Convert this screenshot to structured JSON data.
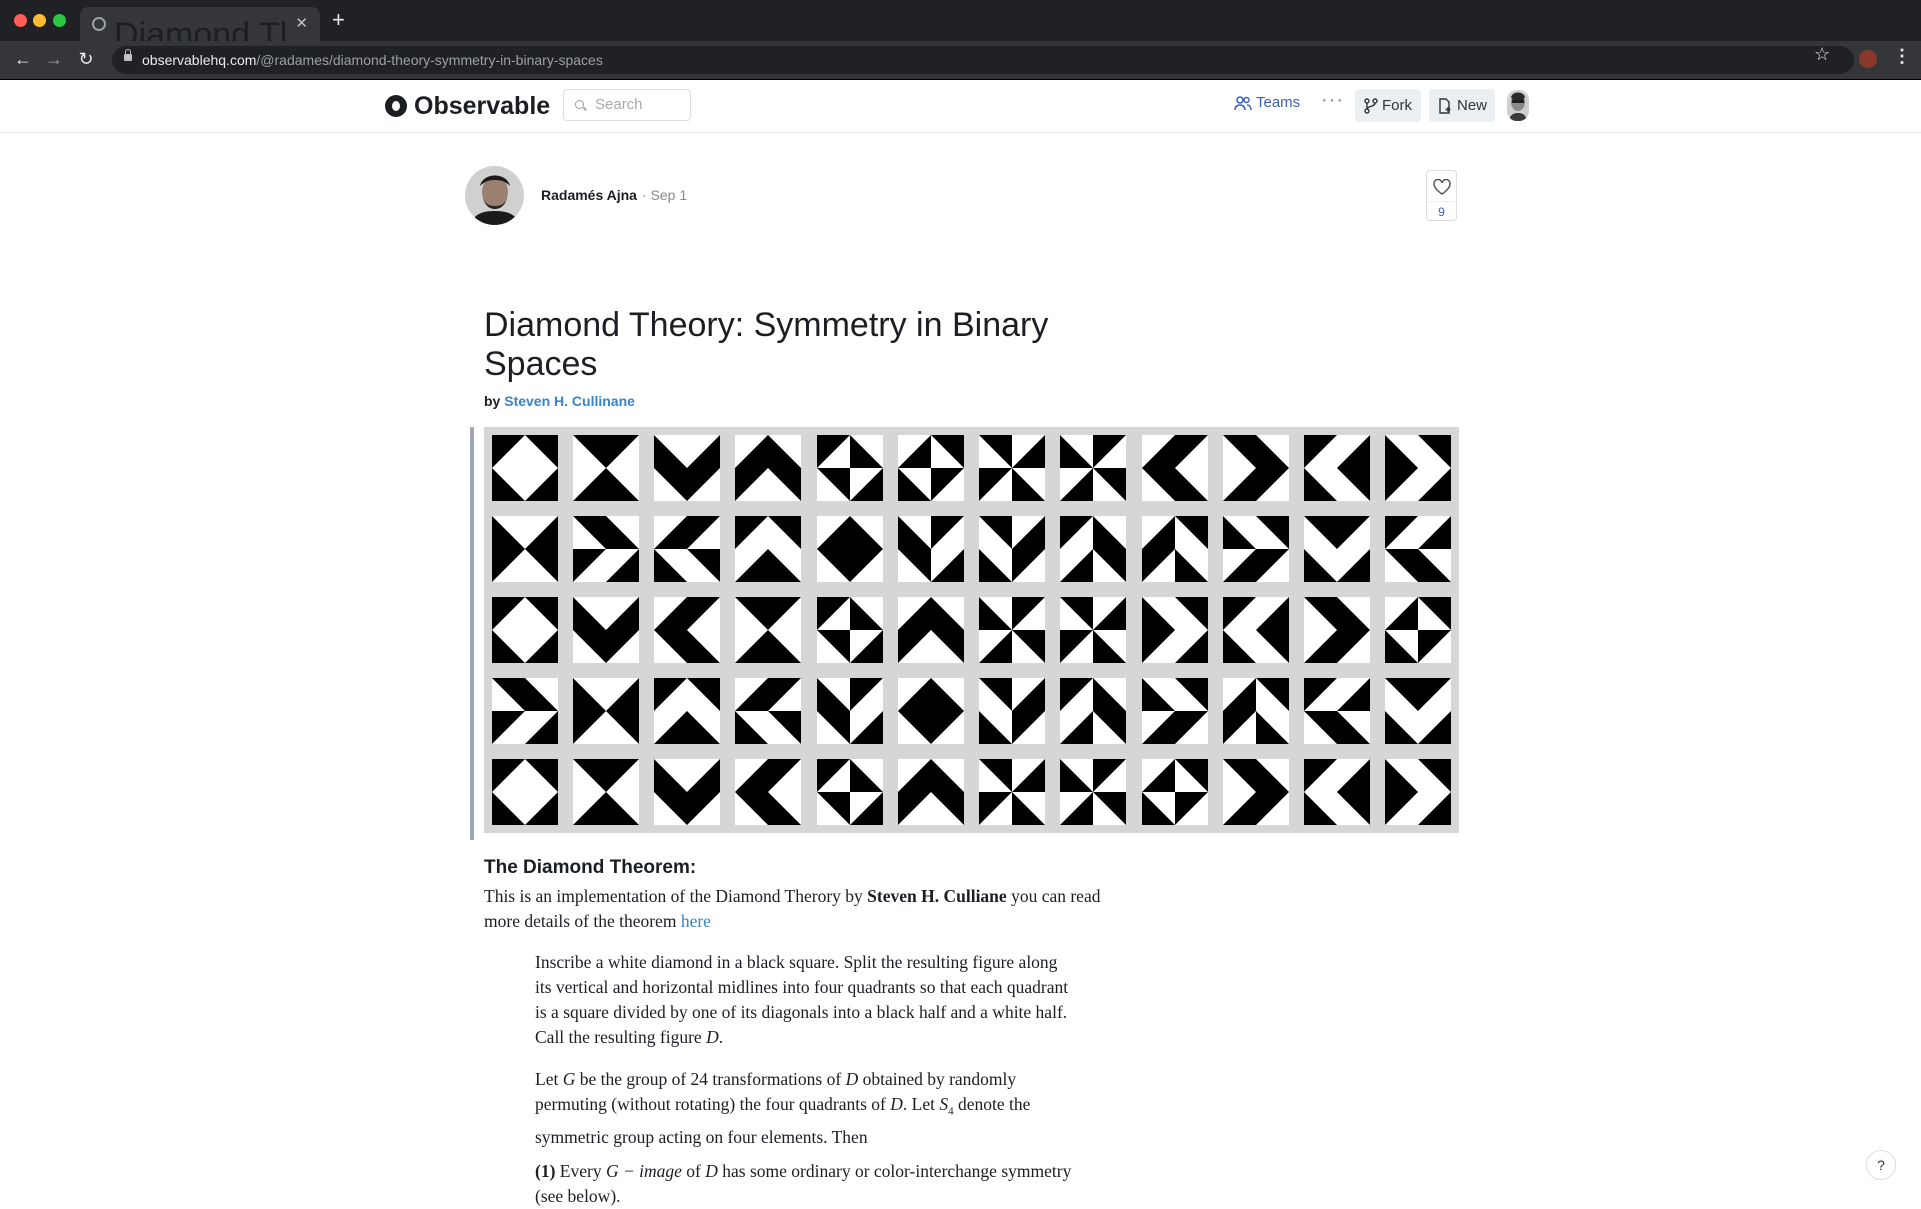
{
  "browser": {
    "tab_title": "Diamond Theory: Symmetry in Binary Spaces",
    "url_host": "observablehq.com",
    "url_path": "/@radames/diamond-theory-symmetry-in-binary-spaces",
    "traffic_colors": [
      "#ff5f57",
      "#febc2e",
      "#28c840"
    ]
  },
  "header": {
    "logo": "Observable",
    "search_placeholder": "Search",
    "teams": "Teams",
    "fork": "Fork",
    "new": "New"
  },
  "meta": {
    "author": "Radamés Ajna",
    "date": "Sep 1",
    "likes": "9"
  },
  "article": {
    "title": "Diamond Theory: Symmetry in Binary Spaces",
    "by_prefix": "by",
    "by_author": "Steven H. Cullinane",
    "section_heading": "The Diamond Theorem:",
    "intro_before": "This is an implementation of the Diamond Therory by ",
    "intro_bold": "Steven H. Culliane",
    "intro_after": " you can read more details of the theorem ",
    "intro_link": "here",
    "quote1_a": "Inscribe a white diamond in a black square. Split the resulting figure along its vertical and horizontal midlines into four quadrants so that each quadrant is a square divided by one of its diagonals into a black half and a white half. Call the resulting figure ",
    "quote1_var": "D",
    "quote1_end": ".",
    "quote2_a": "Let ",
    "quote2_G": "G",
    "quote2_b": " be the group of 24 transformations of ",
    "quote2_D": "D",
    "quote2_c": " obtained by randomly permuting (without rotating) the four quadrants of ",
    "quote2_D2": "D",
    "quote2_d": ". Let ",
    "quote2_S": "S",
    "quote2_sub": "4",
    "quote2_e": " denote the symmetric group acting on four elements. Then",
    "quote3_num": "(1)",
    "quote3_a": " Every ",
    "quote3_math": "G − image",
    "quote3_b": " of ",
    "quote3_D": "D",
    "quote3_c": " has some ordinary or color-interchange symmetry (see below)."
  },
  "diamond_grid": {
    "rows": 5,
    "cols": 12,
    "background": "#d6d6d6",
    "tile_codes": [
      "0123",
      "1032",
      "2310",
      "3201",
      "0213",
      "3120",
      "1302",
      "2031",
      "3012",
      "1230",
      "0321",
      "2103",
      "2301",
      "1203",
      "3021",
      "0132",
      "3210",
      "2013",
      "1320",
      "0231",
      "3102",
      "2130",
      "1023",
      "0312",
      "0123",
      "2310",
      "3012",
      "1032",
      "0213",
      "3201",
      "2031",
      "1302",
      "2103",
      "0321",
      "1230",
      "3120",
      "1203",
      "2301",
      "0132",
      "3021",
      "2013",
      "3210",
      "1320",
      "0231",
      "2130",
      "3102",
      "0312",
      "1023",
      "0123",
      "1032",
      "2310",
      "3012",
      "0213",
      "3201",
      "1302",
      "2031",
      "3120",
      "1230",
      "0321",
      "2103"
    ]
  },
  "misc": {
    "help": "?"
  }
}
